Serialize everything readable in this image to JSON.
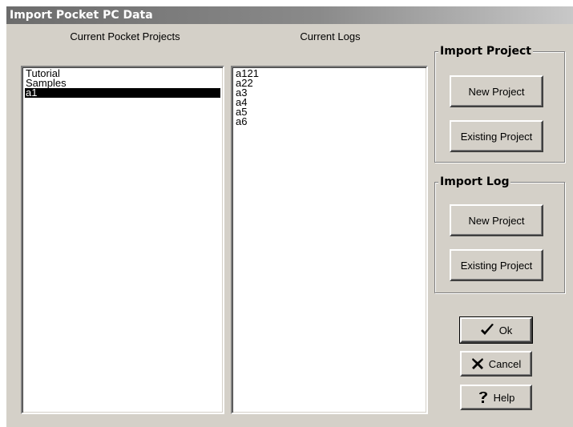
{
  "window": {
    "title": "Import Pocket PC Data"
  },
  "projects": {
    "header": "Current Pocket Projects",
    "items": [
      "Tutorial",
      "Samples",
      "a1"
    ],
    "selected_index": 2
  },
  "logs": {
    "header": "Current Logs",
    "items": [
      "a121",
      "a22",
      "a3",
      "a4",
      "a5",
      "a6"
    ]
  },
  "import_project": {
    "legend": "Import Project",
    "new_label": "New Project",
    "existing_label": "Existing Project"
  },
  "import_log": {
    "legend": "Import Log",
    "new_label": "New Project",
    "existing_label": "Existing Project"
  },
  "actions": {
    "ok_label": "Ok",
    "cancel_label": "Cancel",
    "help_label": "Help"
  },
  "icons": {
    "ok": "checkmark-icon",
    "cancel": "x-mark-icon",
    "help": "question-mark-icon"
  },
  "colors": {
    "face": "#d4d0c8",
    "selection": "#000000",
    "title_start": "#6c6c6c",
    "title_end": "#c8c8c8"
  }
}
